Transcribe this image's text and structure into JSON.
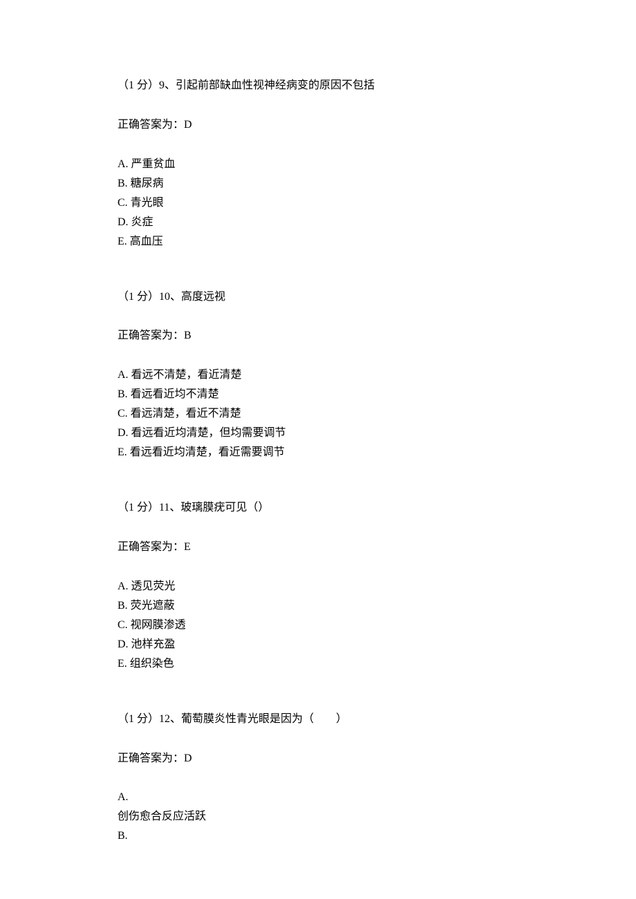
{
  "questions": [
    {
      "header": "（1 分）9、引起前部缺血性视神经病变的原因不包括",
      "answer": "正确答案为：D",
      "options": [
        "A. 严重贫血",
        "B. 糖尿病",
        "C. 青光眼",
        "D. 炎症",
        "E. 高血压"
      ]
    },
    {
      "header": "（1 分）10、高度远视",
      "answer": "正确答案为：B",
      "options": [
        "A. 看远不清楚，看近清楚",
        "B. 看远看近均不清楚",
        "C. 看远清楚，看近不清楚",
        "D. 看远看近均清楚，但均需要调节",
        "E. 看远看近均清楚，看近需要调节"
      ]
    },
    {
      "header": "（1 分）11、玻璃膜疣可见（）",
      "answer": "正确答案为：E",
      "options": [
        "A. 透见荧光",
        "B. 荧光遮蔽",
        "C. 视网膜渗透",
        "D. 池样充盈",
        "E. 组织染色"
      ]
    },
    {
      "header": "（1 分）12、葡萄膜炎性青光眼是因为（　　）",
      "answer": "正确答案为：D",
      "options": [
        "A.",
        "创伤愈合反应活跃",
        "B."
      ]
    }
  ]
}
